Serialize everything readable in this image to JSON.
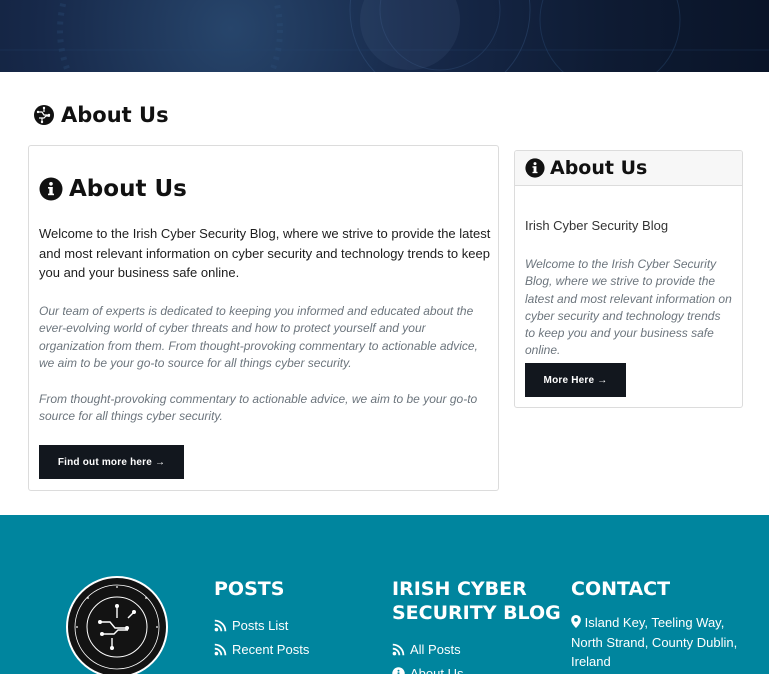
{
  "page": {
    "title": "About Us"
  },
  "main_card": {
    "heading": "About Us",
    "lead": "Welcome to the Irish Cyber Security Blog, where we strive to provide the latest and most relevant information on cyber security and technology trends to keep you and your business safe online.",
    "para1": "Our team of experts is dedicated to keeping you informed and educated about the ever-evolving world of cyber threats and how to protect yourself and your organization from them. From thought-provoking commentary to actionable advice, we aim to be your go-to source for all things cyber security.",
    "para2": "From thought-provoking commentary to actionable advice, we aim to be your go-to source for all things cyber security.",
    "button": "Find out more here →"
  },
  "side_card": {
    "heading": "About Us",
    "subtitle": "Irish Cyber Security Blog",
    "text": "Welcome to the Irish Cyber Security Blog, where we strive to provide the latest and most relevant information on cyber security and technology trends to keep you and your business safe online.",
    "button": "More Here →"
  },
  "footer": {
    "posts": {
      "heading": "POSTS",
      "links": [
        "Posts List",
        "Recent Posts"
      ]
    },
    "blog": {
      "heading": "IRISH CYBER SECURITY BLOG",
      "links": [
        "All Posts",
        "About Us"
      ]
    },
    "contact": {
      "heading": "CONTACT",
      "address": "Island Key, Teeling Way, North Strand, County Dublin, Ireland"
    }
  },
  "colors": {
    "footer_bg": "#00859e",
    "button_bg": "#12171e",
    "hero_bg": "#0e1b33"
  },
  "icons": [
    "circuit-logo-icon",
    "info-circle-icon",
    "rss-icon",
    "map-marker-icon"
  ]
}
